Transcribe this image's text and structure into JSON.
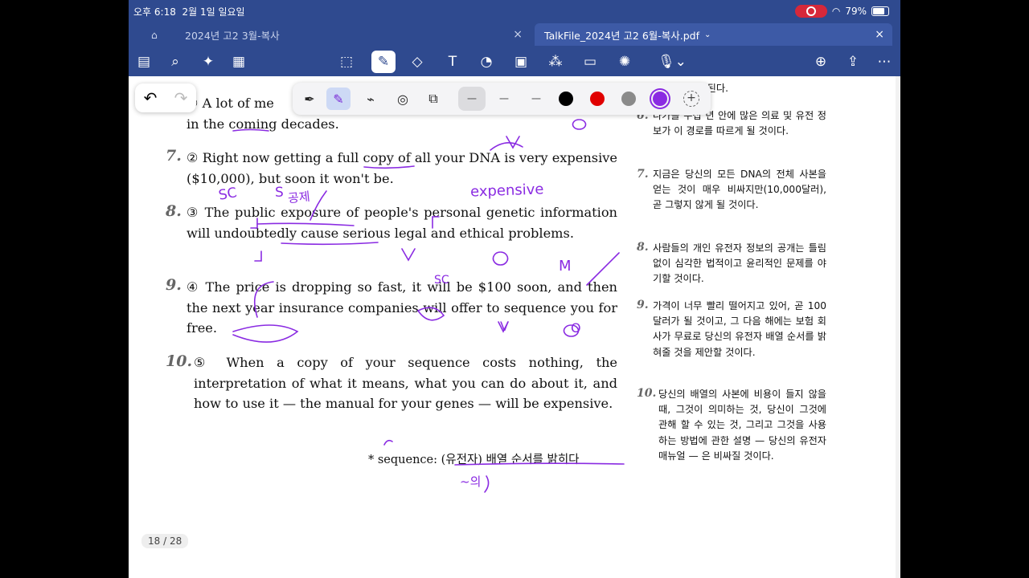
{
  "status_bar": {
    "time": "오후 6:18",
    "date": "2월 1일 일요일",
    "battery": "79%"
  },
  "tabs": [
    {
      "label": "2024년 고2 3월-복사"
    },
    {
      "label": "TalkFile_2024년 고2 6월-복사.pdf"
    }
  ],
  "toolbar_icons": [
    "sidebar-icon",
    "search-icon",
    "ai-sparkle-icon",
    "page-icon",
    "lasso-icon",
    "pen-icon",
    "eraser-icon",
    "text-icon",
    "shape-icon",
    "image-icon",
    "elements-icon",
    "sticky-note-icon",
    "laser-pointer-icon",
    "microphone-icon",
    "add-page-icon",
    "share-icon",
    "more-icon"
  ],
  "pen_toolbar": {
    "tools": [
      "fountain-pen",
      "highlighter",
      "brush",
      "lasso-shape",
      "shapes"
    ],
    "sizes": [
      "size-1",
      "size-2",
      "size-3"
    ],
    "colors": [
      "#000000",
      "#e00000",
      "#8a8a8a",
      "#8a2be2"
    ],
    "selected_color": "#8a2be2"
  },
  "document": {
    "english": {
      "p6_line": "① A lot of medical ... in the coming decades.",
      "p6a": "① A lot of me",
      "p6b": "in the coming decades.",
      "p7_num": "7.",
      "p7": "② Right now getting a full copy of all your DNA is very expensive ($10,000), but soon it won't be.",
      "p8_num": "8.",
      "p8": "③ The public exposure of people's personal genetic information will undoubtedly cause serious legal and ethical problems.",
      "p9_num": "9.",
      "p9": "④ The price is dropping so fast, it will be $100 soon, and then the next year insurance companies will offer to sequence you for free.",
      "p10_num": "10.",
      "p10": "⑤ When a copy of your sequence costs nothing, the interpretation of what it means, what you can do about it, and how to use it — the manual for your genes — will be expensive.",
      "footnote": "* sequence: (유전자) 배열 순서를 밝히다"
    },
    "korean": {
      "k5_tail": "게 가치 있게 된다.",
      "k6_num": "6.",
      "k6": "다가올 수십 년 안에 많은 의료 및 유전 정보가 이 경로를 따르게 될 것이다.",
      "k7_num": "7.",
      "k7": "지금은 당신의 모든 DNA의 전체 사본을 얻는 것이 매우 비싸지만(10,000달러), 곧 그렇지 않게 될 것이다.",
      "k8_num": "8.",
      "k8": "사람들의 개인 유전자 정보의 공개는 틀림없이 심각한 법적이고 윤리적인 문제를 야기할 것이다.",
      "k9_num": "9.",
      "k9": "가격이 너무 빨리 떨어지고 있어, 곧 100달러가 될 것이고, 그 다음 해에는 보험 회사가 무료로 당신의 유전자 배열 순서를 밝혀줄 것을 제안할 것이다.",
      "k10_num": "10.",
      "k10": "당신의 배열의 사본에 비용이 들지 않을 때, 그것이 의미하는 것, 당신이 그것에 관해 할 수 있는 것, 그리고 그것을 사용하는 방법에 관한 설명 — 당신의 유전자 매뉴얼 — 은 비싸질 것이다."
    },
    "annotations": [
      "SC",
      "S",
      "공제",
      "expensive",
      "V",
      "O",
      "M",
      "SC",
      "~의"
    ],
    "page_indicator": "18 / 28"
  }
}
